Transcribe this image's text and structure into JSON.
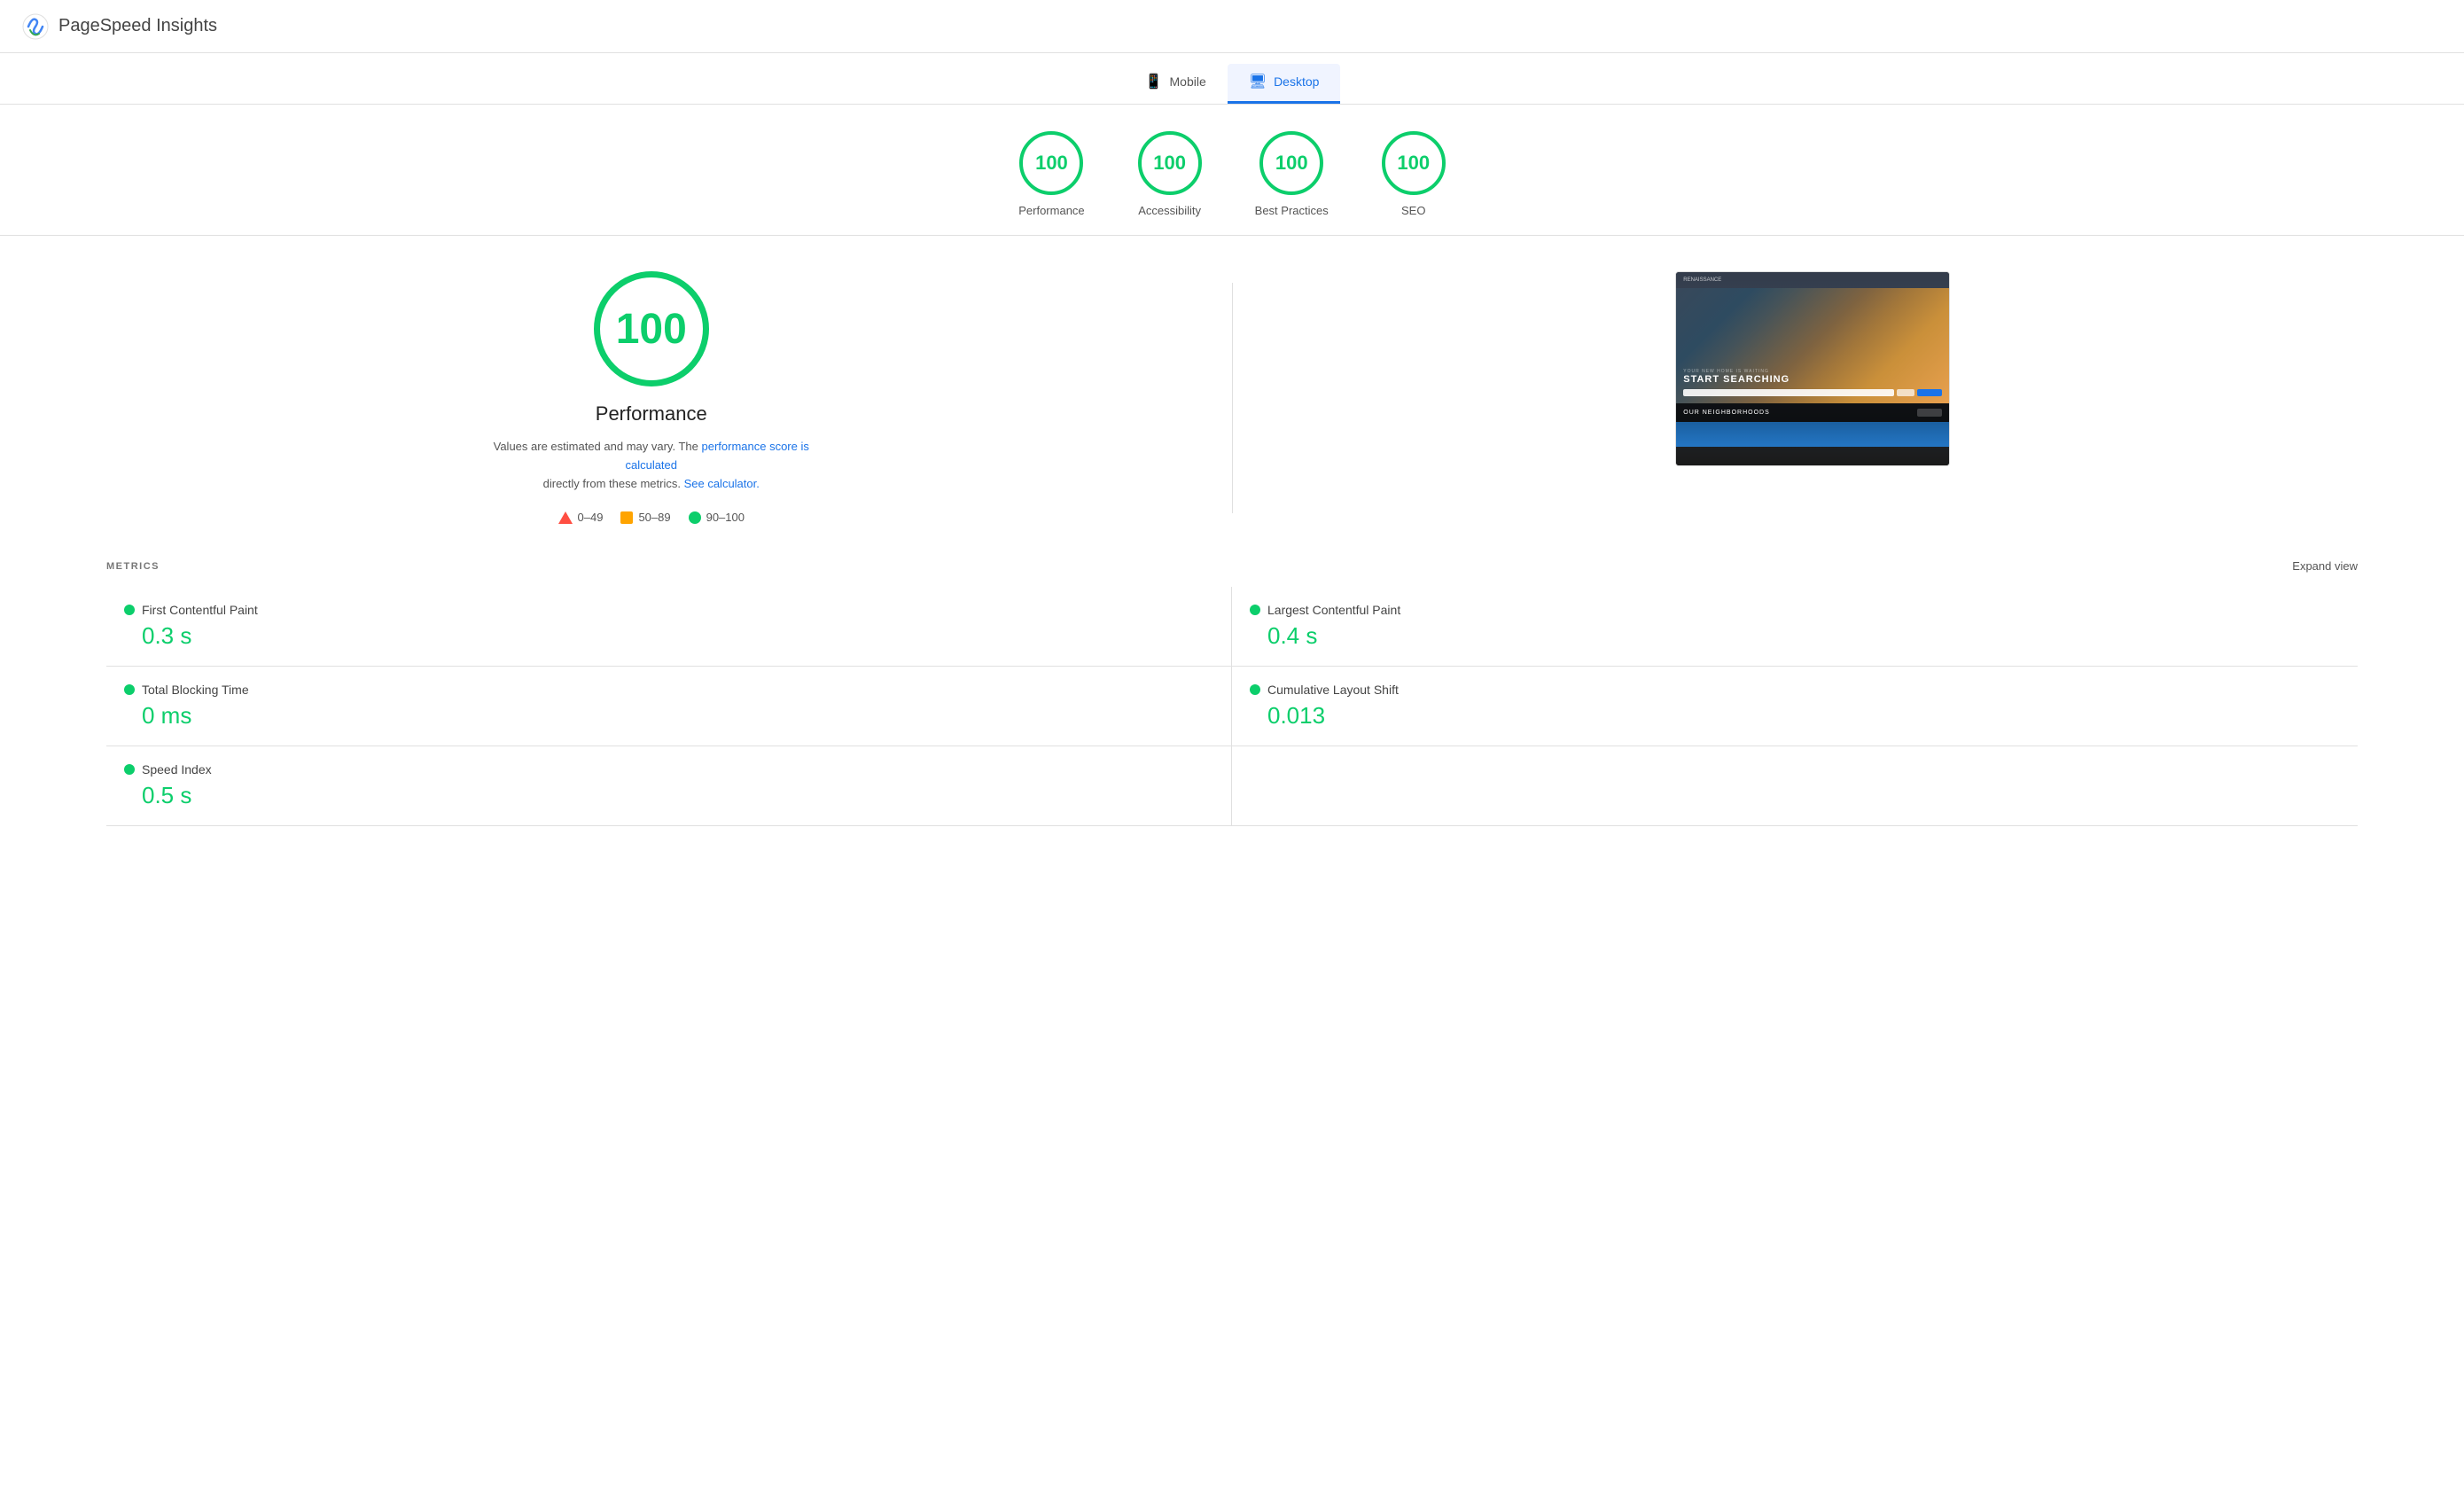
{
  "app": {
    "title": "PageSpeed Insights"
  },
  "tabs": {
    "mobile": {
      "label": "Mobile",
      "icon": "📱"
    },
    "desktop": {
      "label": "Desktop",
      "icon": "🖥",
      "active": true
    }
  },
  "scores": [
    {
      "id": "performance",
      "value": "100",
      "label": "Performance"
    },
    {
      "id": "accessibility",
      "value": "100",
      "label": "Accessibility"
    },
    {
      "id": "best-practices",
      "value": "100",
      "label": "Best Practices"
    },
    {
      "id": "seo",
      "value": "100",
      "label": "SEO"
    }
  ],
  "main": {
    "big_score": "100",
    "big_score_label": "Performance",
    "score_note_1": "Values are estimated and may vary. The",
    "score_note_link_1": "performance score is calculated",
    "score_note_2": "directly from these metrics.",
    "score_note_link_2": "See calculator.",
    "legend": [
      {
        "id": "fail",
        "range": "0–49",
        "type": "triangle",
        "color": "#ff4e42"
      },
      {
        "id": "average",
        "range": "50–89",
        "type": "square",
        "color": "#ffa400"
      },
      {
        "id": "pass",
        "range": "90–100",
        "type": "circle",
        "color": "#0cce6b"
      }
    ]
  },
  "metrics": {
    "title": "METRICS",
    "expand_label": "Expand view",
    "items": [
      {
        "id": "fcp",
        "name": "First Contentful Paint",
        "value": "0.3 s",
        "color": "#0cce6b"
      },
      {
        "id": "lcp",
        "name": "Largest Contentful Paint",
        "value": "0.4 s",
        "color": "#0cce6b"
      },
      {
        "id": "tbt",
        "name": "Total Blocking Time",
        "value": "0 ms",
        "color": "#0cce6b"
      },
      {
        "id": "cls",
        "name": "Cumulative Layout Shift",
        "value": "0.013",
        "color": "#0cce6b"
      },
      {
        "id": "si",
        "name": "Speed Index",
        "value": "0.5 s",
        "color": "#0cce6b"
      }
    ]
  }
}
